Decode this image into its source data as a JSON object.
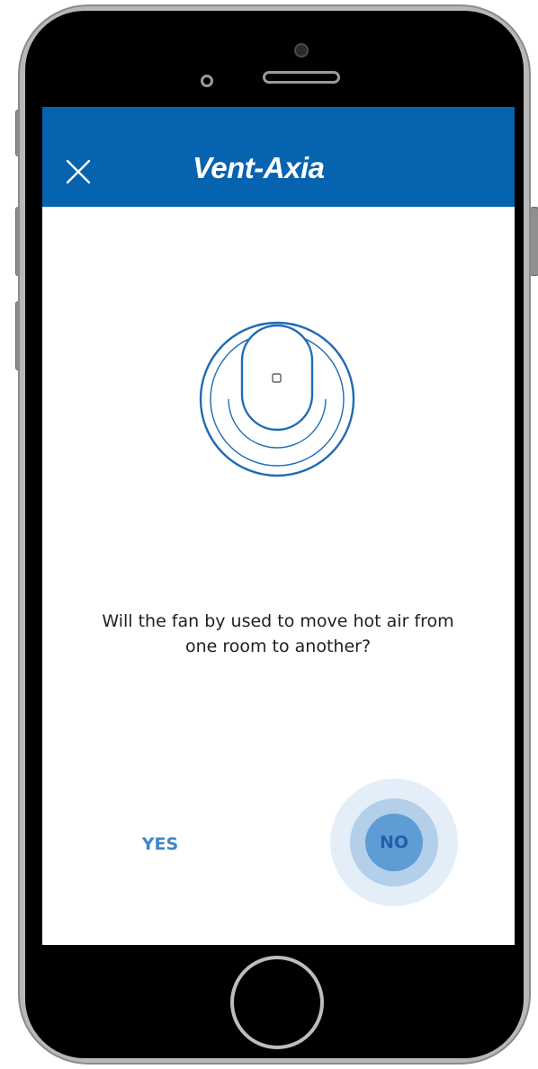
{
  "app": {
    "brand": "Vent-Axia"
  },
  "header": {
    "close_icon": "close-icon",
    "background_color": "#0563af"
  },
  "illustration": {
    "icon": "fan-unit-icon"
  },
  "question": {
    "text": "Will the fan by used to move hot air from one room to another?"
  },
  "actions": {
    "yes_label": "YES",
    "no_label": "NO",
    "accent_color": "#3b87cc"
  }
}
